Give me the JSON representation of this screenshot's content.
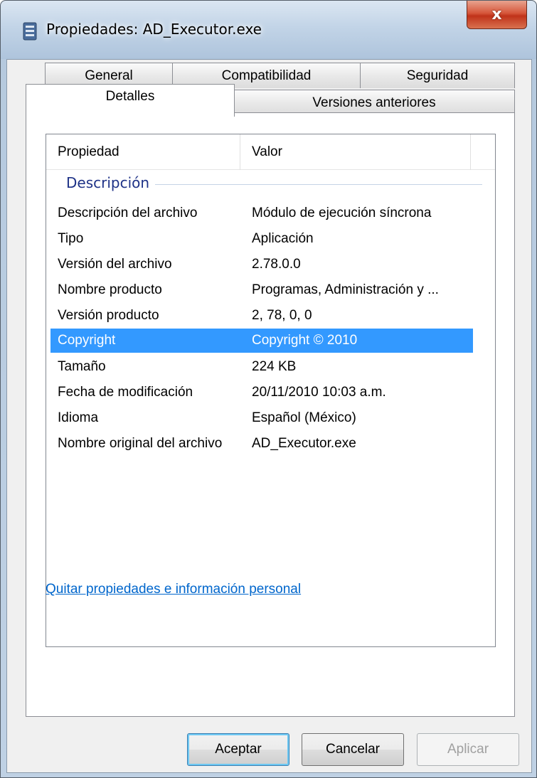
{
  "window": {
    "title": "Propiedades: AD_Executor.exe",
    "close_label": "x"
  },
  "tabs": [
    {
      "label": "General",
      "active": false
    },
    {
      "label": "Compatibilidad",
      "active": false
    },
    {
      "label": "Seguridad",
      "active": false
    },
    {
      "label": "Detalles",
      "active": true
    },
    {
      "label": "Versiones anteriores",
      "active": false
    }
  ],
  "list": {
    "headers": {
      "property": "Propiedad",
      "value": "Valor"
    },
    "group": "Descripción",
    "rows": [
      {
        "property": "Descripción del archivo",
        "value": "Módulo de ejecución síncrona"
      },
      {
        "property": "Tipo",
        "value": "Aplicación"
      },
      {
        "property": "Versión del archivo",
        "value": "2.78.0.0"
      },
      {
        "property": "Nombre producto",
        "value": "Programas, Administración y ..."
      },
      {
        "property": "Versión producto",
        "value": "2, 78, 0, 0"
      },
      {
        "property": "Copyright",
        "value": "Copyright © 2010",
        "selected": true
      },
      {
        "property": "Tamaño",
        "value": "224 KB"
      },
      {
        "property": "Fecha de modificación",
        "value": "20/11/2010 10:03 a.m."
      },
      {
        "property": "Idioma",
        "value": "Español (México)"
      },
      {
        "property": "Nombre original del archivo",
        "value": "AD_Executor.exe"
      }
    ]
  },
  "link": "Quitar propiedades e información personal",
  "buttons": {
    "ok": "Aceptar",
    "cancel": "Cancelar",
    "apply": "Aplicar"
  },
  "colors": {
    "selection": "#3399ff",
    "group_label": "#1e3287",
    "link": "#0066cc"
  }
}
